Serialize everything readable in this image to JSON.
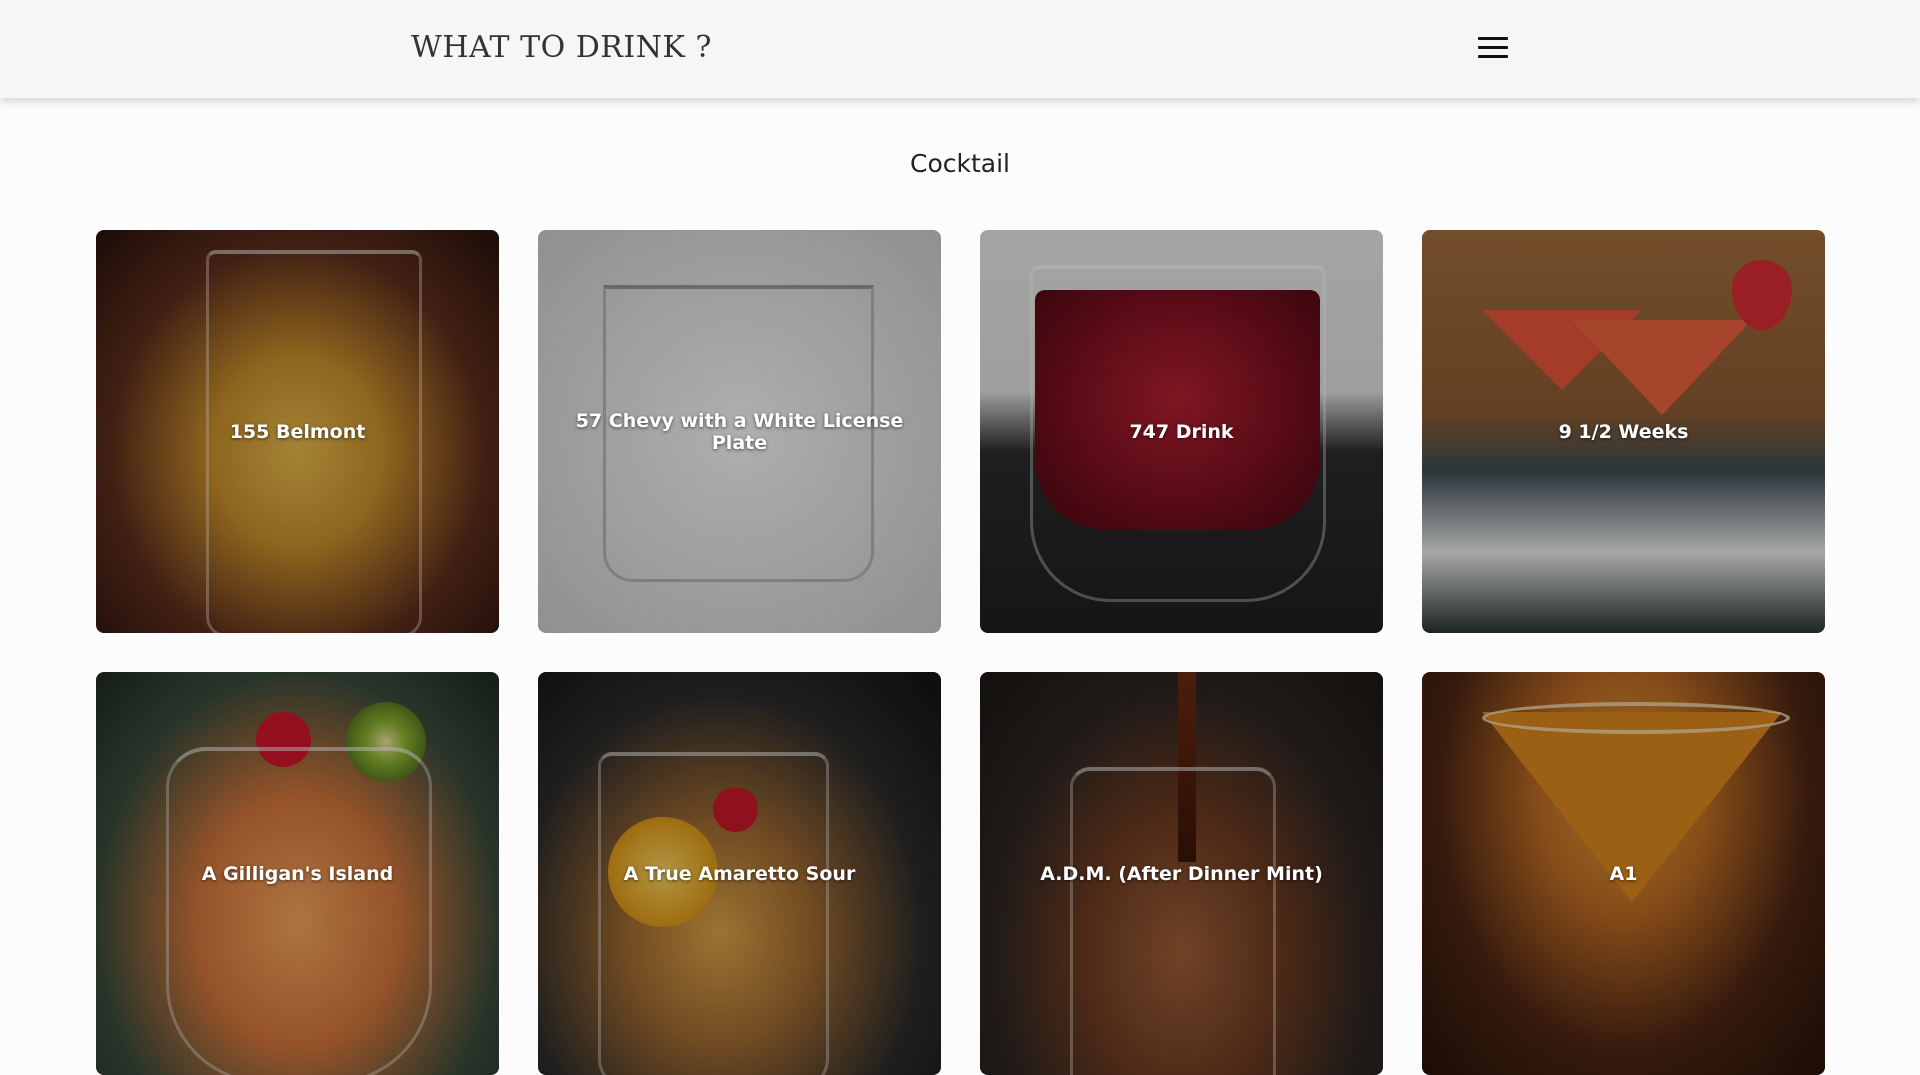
{
  "header": {
    "brand": "WHAT TO DRINK ?",
    "menu_icon": "hamburger-menu-icon"
  },
  "section": {
    "title": "Cocktail"
  },
  "drinks": [
    {
      "name": "155 Belmont"
    },
    {
      "name": "57 Chevy with a White License Plate"
    },
    {
      "name": "747 Drink"
    },
    {
      "name": "9 1/2 Weeks"
    },
    {
      "name": "A Gilligan's Island"
    },
    {
      "name": "A True Amaretto Sour"
    },
    {
      "name": "A.D.M. (After Dinner Mint)"
    },
    {
      "name": "A1"
    }
  ]
}
